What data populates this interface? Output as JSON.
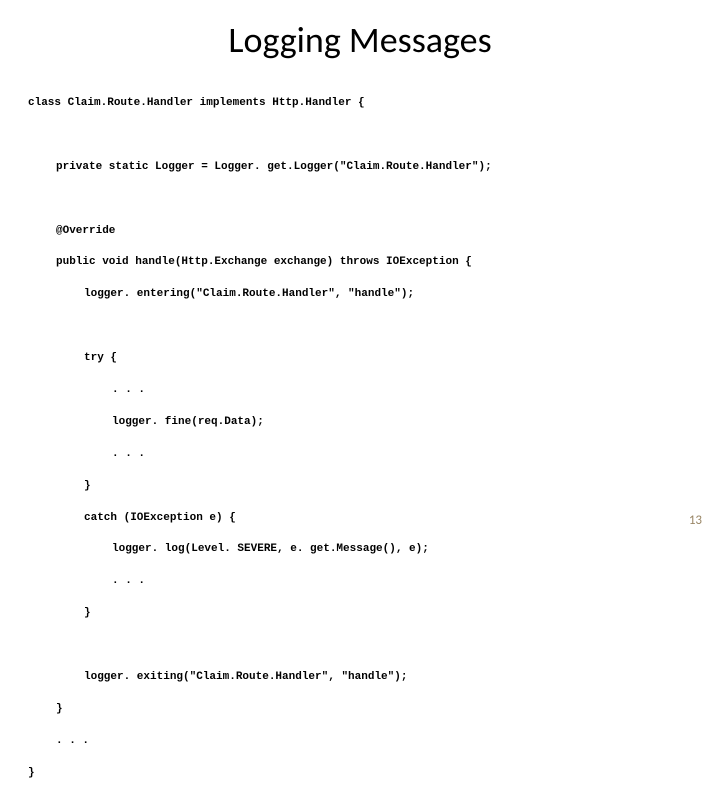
{
  "title": "Logging Messages",
  "pageNumber": "13",
  "code": {
    "l1": "class Claim.Route.Handler implements Http.Handler {",
    "l2": "private static Logger = Logger. get.Logger(\"Claim.Route.Handler\");",
    "l3": "@Override",
    "l4": "public void handle(Http.Exchange exchange) throws IOException {",
    "l5": "logger. entering(\"Claim.Route.Handler\", \"handle\");",
    "l6": "try {",
    "l7": ". . .",
    "l8": "logger. fine(req.Data);",
    "l9": ". . .",
    "l10": "}",
    "l11": "catch (IOException e) {",
    "l12": "logger. log(Level. SEVERE, e. get.Message(), e);",
    "l13": ". . .",
    "l14": "}",
    "l15": "logger. exiting(\"Claim.Route.Handler\", \"handle\");",
    "l16": "}",
    "l17": ". . .",
    "l18": "}"
  }
}
